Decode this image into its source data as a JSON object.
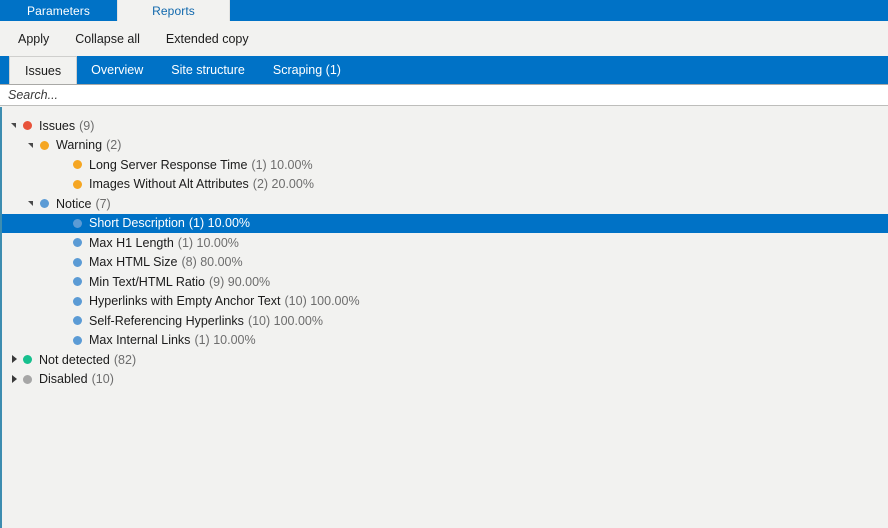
{
  "window_tabs": [
    {
      "label": "Parameters",
      "active": false
    },
    {
      "label": "Reports",
      "active": true
    }
  ],
  "toolbar": {
    "apply_label": "Apply",
    "collapse_all_label": "Collapse all",
    "extended_copy_label": "Extended copy"
  },
  "section_tabs": [
    {
      "label": "Issues",
      "active": true
    },
    {
      "label": "Overview",
      "active": false
    },
    {
      "label": "Site structure",
      "active": false
    },
    {
      "label": "Scraping (1)",
      "active": false
    }
  ],
  "search": {
    "value": "",
    "placeholder": "Search..."
  },
  "colors": {
    "accent_blue": "#0072c6",
    "error_red": "#e8533a",
    "warning_orange": "#f5a623",
    "notice_blue": "#5b9bd5",
    "not_detected_green": "#17c08e",
    "disabled_gray": "#a6a6a6",
    "panel_bg": "#f2f2f0",
    "left_rule": "#3d8db0"
  },
  "tree": [
    {
      "label": "Issues",
      "meta": "(9)",
      "indent": 0,
      "dot": "error_red",
      "state": "expanded",
      "selected": false,
      "dot_name": "status-dot-error"
    },
    {
      "label": "Warning",
      "meta": "(2)",
      "indent": 1,
      "dot": "warning_orange",
      "state": "expanded",
      "selected": false,
      "dot_name": "status-dot-warning"
    },
    {
      "label": "Long Server Response Time",
      "meta": "(1) 10.00%",
      "indent": 2,
      "dot": "warning_orange",
      "state": "leaf",
      "selected": false,
      "dot_name": "status-dot-warning"
    },
    {
      "label": "Images Without Alt Attributes",
      "meta": "(2) 20.00%",
      "indent": 2,
      "dot": "warning_orange",
      "state": "leaf",
      "selected": false,
      "dot_name": "status-dot-warning"
    },
    {
      "label": "Notice",
      "meta": "(7)",
      "indent": 1,
      "dot": "notice_blue",
      "state": "expanded",
      "selected": false,
      "dot_name": "status-dot-notice"
    },
    {
      "label": "Short Description",
      "meta": "(1) 10.00%",
      "indent": 2,
      "dot": "notice_blue",
      "state": "leaf",
      "selected": true,
      "dot_name": "status-dot-notice"
    },
    {
      "label": "Max H1 Length",
      "meta": "(1) 10.00%",
      "indent": 2,
      "dot": "notice_blue",
      "state": "leaf",
      "selected": false,
      "dot_name": "status-dot-notice"
    },
    {
      "label": "Max HTML Size",
      "meta": "(8) 80.00%",
      "indent": 2,
      "dot": "notice_blue",
      "state": "leaf",
      "selected": false,
      "dot_name": "status-dot-notice"
    },
    {
      "label": "Min Text/HTML Ratio",
      "meta": "(9) 90.00%",
      "indent": 2,
      "dot": "notice_blue",
      "state": "leaf",
      "selected": false,
      "dot_name": "status-dot-notice"
    },
    {
      "label": "Hyperlinks with Empty Anchor Text",
      "meta": "(10) 100.00%",
      "indent": 2,
      "dot": "notice_blue",
      "state": "leaf",
      "selected": false,
      "dot_name": "status-dot-notice"
    },
    {
      "label": "Self-Referencing Hyperlinks",
      "meta": "(10) 100.00%",
      "indent": 2,
      "dot": "notice_blue",
      "state": "leaf",
      "selected": false,
      "dot_name": "status-dot-notice"
    },
    {
      "label": "Max Internal Links",
      "meta": "(1) 10.00%",
      "indent": 2,
      "dot": "notice_blue",
      "state": "leaf",
      "selected": false,
      "dot_name": "status-dot-notice"
    },
    {
      "label": "Not detected",
      "meta": "(82)",
      "indent": 0,
      "dot": "not_detected_green",
      "state": "collapsed",
      "selected": false,
      "dot_name": "status-dot-not-detected"
    },
    {
      "label": "Disabled",
      "meta": "(10)",
      "indent": 0,
      "dot": "disabled_gray",
      "state": "collapsed",
      "selected": false,
      "dot_name": "status-dot-disabled"
    }
  ]
}
